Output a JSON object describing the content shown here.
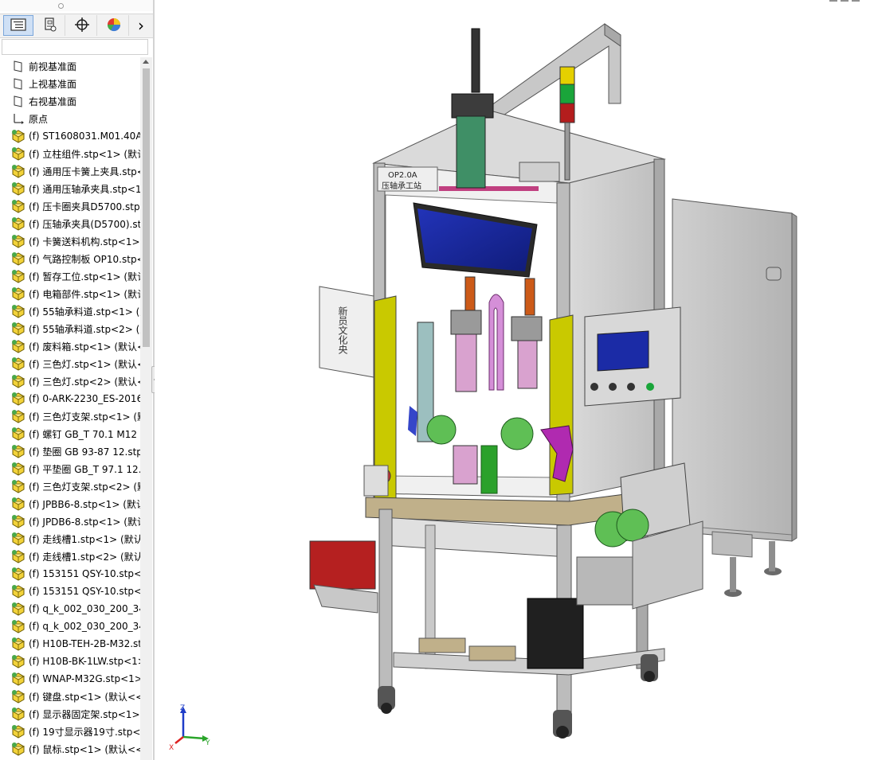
{
  "feature_tree": {
    "tabs": [
      {
        "name": "featuremanager-tab",
        "icon": "feature-tree-icon",
        "active": true
      },
      {
        "name": "propertymanager-tab",
        "icon": "property-manager-icon",
        "active": false
      },
      {
        "name": "configurationmanager-tab",
        "icon": "crosshair-icon",
        "active": false
      },
      {
        "name": "displaymanager-tab",
        "icon": "appearance-pie-icon",
        "active": false
      },
      {
        "name": "more-tabs",
        "icon": "chevron-right-icon",
        "active": false
      }
    ],
    "more_glyph": "›",
    "items": [
      {
        "kind": "plane",
        "label": "前视基准面"
      },
      {
        "kind": "plane",
        "label": "上视基准面"
      },
      {
        "kind": "plane",
        "label": "右视基准面"
      },
      {
        "kind": "origin",
        "label": "原点"
      },
      {
        "kind": "part",
        "label": "(f) ST1608031.M01.40A.0"
      },
      {
        "kind": "part",
        "label": "(f) 立柱组件.stp<1> (默认"
      },
      {
        "kind": "part",
        "label": "(f) 通用压卡簧上夹具.stp<"
      },
      {
        "kind": "part",
        "label": "(f) 通用压轴承夹具.stp<1"
      },
      {
        "kind": "part",
        "label": "(f) 压卡圈夹具D5700.stp<"
      },
      {
        "kind": "part",
        "label": "(f) 压轴承夹具(D5700).stp"
      },
      {
        "kind": "part",
        "label": "(f) 卡簧送料机构.stp<1>"
      },
      {
        "kind": "part",
        "label": "(f) 气路控制板 OP10.stp<"
      },
      {
        "kind": "part",
        "label": "(f) 暂存工位.stp<1> (默认"
      },
      {
        "kind": "part",
        "label": "(f) 电箱部件.stp<1> (默认"
      },
      {
        "kind": "part",
        "label": "(f) 55轴承料道.stp<1> (默"
      },
      {
        "kind": "part",
        "label": "(f) 55轴承料道.stp<2> (默"
      },
      {
        "kind": "part",
        "label": "(f) 废料箱.stp<1> (默认<"
      },
      {
        "kind": "part",
        "label": "(f) 三色灯.stp<1> (默认<"
      },
      {
        "kind": "part",
        "label": "(f) 三色灯.stp<2> (默认<"
      },
      {
        "kind": "part",
        "label": "(f) 0-ARK-2230_ES-2016"
      },
      {
        "kind": "part",
        "label": "(f) 三色灯支架.stp<1> (默"
      },
      {
        "kind": "part",
        "label": "(f) 螺钉 GB_T 70.1 M12 x"
      },
      {
        "kind": "part",
        "label": "(f) 垫圈 GB 93-87 12.stp"
      },
      {
        "kind": "part",
        "label": "(f) 平垫圈 GB_T 97.1 12.s"
      },
      {
        "kind": "part",
        "label": "(f) 三色灯支架.stp<2> (默"
      },
      {
        "kind": "part",
        "label": "(f) JPBB6-8.stp<1> (默认"
      },
      {
        "kind": "part",
        "label": "(f) JPDB6-8.stp<1> (默认"
      },
      {
        "kind": "part",
        "label": "(f) 走线槽1.stp<1> (默认"
      },
      {
        "kind": "part",
        "label": "(f) 走线槽1.stp<2> (默认"
      },
      {
        "kind": "part",
        "label": "(f) 153151 QSY-10.stp<1"
      },
      {
        "kind": "part",
        "label": "(f) 153151 QSY-10.stp<2"
      },
      {
        "kind": "part",
        "label": "(f) q_k_002_030_200_34_"
      },
      {
        "kind": "part",
        "label": "(f) q_k_002_030_200_34_"
      },
      {
        "kind": "part",
        "label": "(f) H10B-TEH-2B-M32.st"
      },
      {
        "kind": "part",
        "label": "(f) H10B-BK-1LW.stp<1>"
      },
      {
        "kind": "part",
        "label": "(f) WNAP-M32G.stp<1>"
      },
      {
        "kind": "part",
        "label": "(f) 键盘.stp<1> (默认<<默"
      },
      {
        "kind": "part",
        "label": "(f) 显示器固定架.stp<1>"
      },
      {
        "kind": "part",
        "label": "(f) 19寸显示器19寸.stp<1"
      },
      {
        "kind": "part",
        "label": "(f) 鼠标.stp<1> (默认<<默"
      }
    ]
  },
  "model": {
    "sign_left": "新员文化央",
    "sign_top_line1": "OP2.0A",
    "sign_top_line2": "压轴承工站",
    "accent_yellow": "#c9c900",
    "screen_blue": "#1b2ba6",
    "frame_gray": "#b8b8b8"
  },
  "triad": {
    "x": "X",
    "y": "Y",
    "z": "Z"
  }
}
